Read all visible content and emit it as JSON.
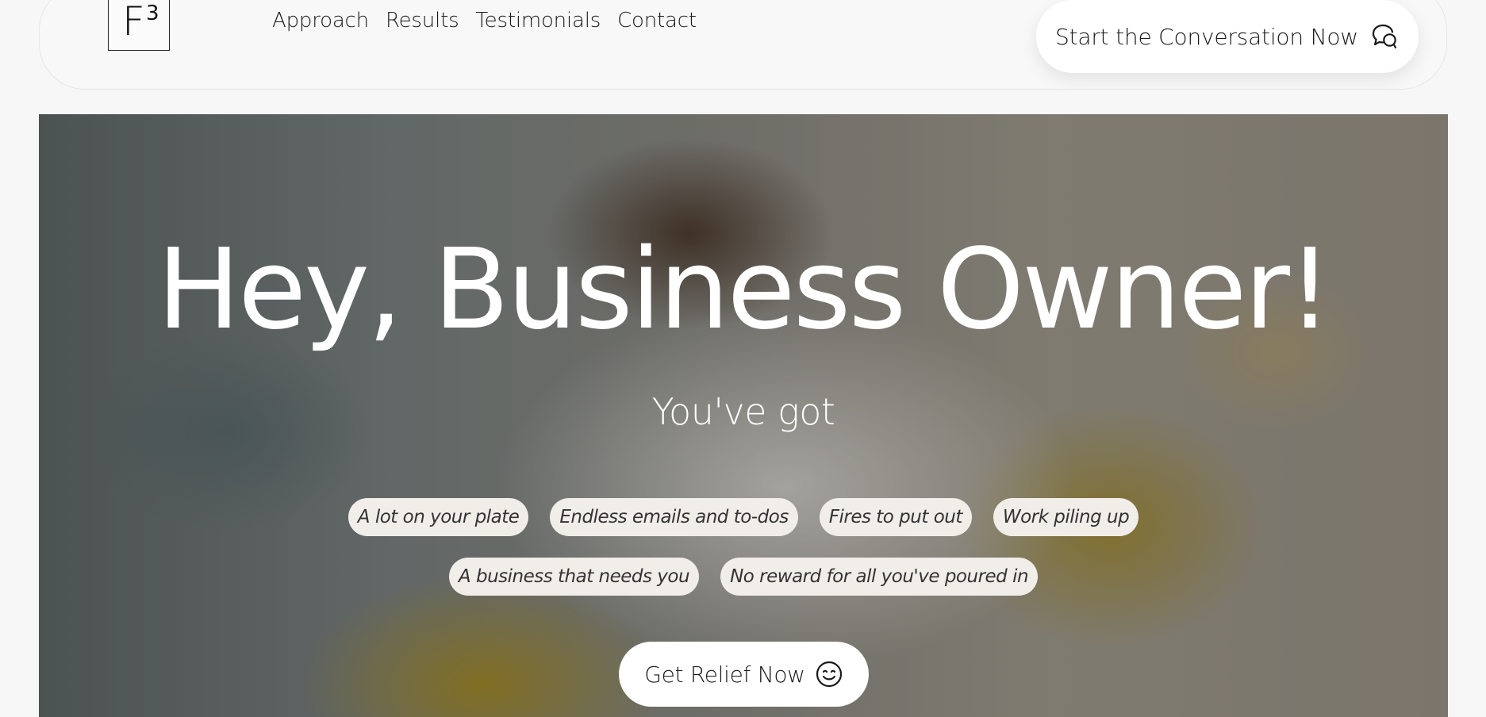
{
  "header": {
    "logo": {
      "letter": "F",
      "superscript": "3"
    },
    "nav": [
      {
        "label": "Approach"
      },
      {
        "label": "Results"
      },
      {
        "label": "Testimonials"
      },
      {
        "label": "Contact"
      }
    ],
    "cta": {
      "label": "Start the Conversation Now",
      "icon": "chat-bubbles-icon"
    }
  },
  "hero": {
    "headline": "Hey, Business Owner!",
    "subheadline": "You've got",
    "tags_row1": [
      "A lot on your plate",
      "Endless emails and to-dos",
      "Fires to put out",
      "Work piling up"
    ],
    "tags_row2": [
      "A business that needs you",
      "No reward for all you've poured in"
    ],
    "cta": {
      "label": "Get Relief Now",
      "icon": "smiley-icon"
    }
  },
  "colors": {
    "page_bg": "#f7f7f7",
    "header_bg": "#f8f8f8",
    "button_bg": "#ffffff",
    "tag_bg": "#f1eeea",
    "headline_text": "#ffffff",
    "body_text": "#1a1a1a"
  }
}
